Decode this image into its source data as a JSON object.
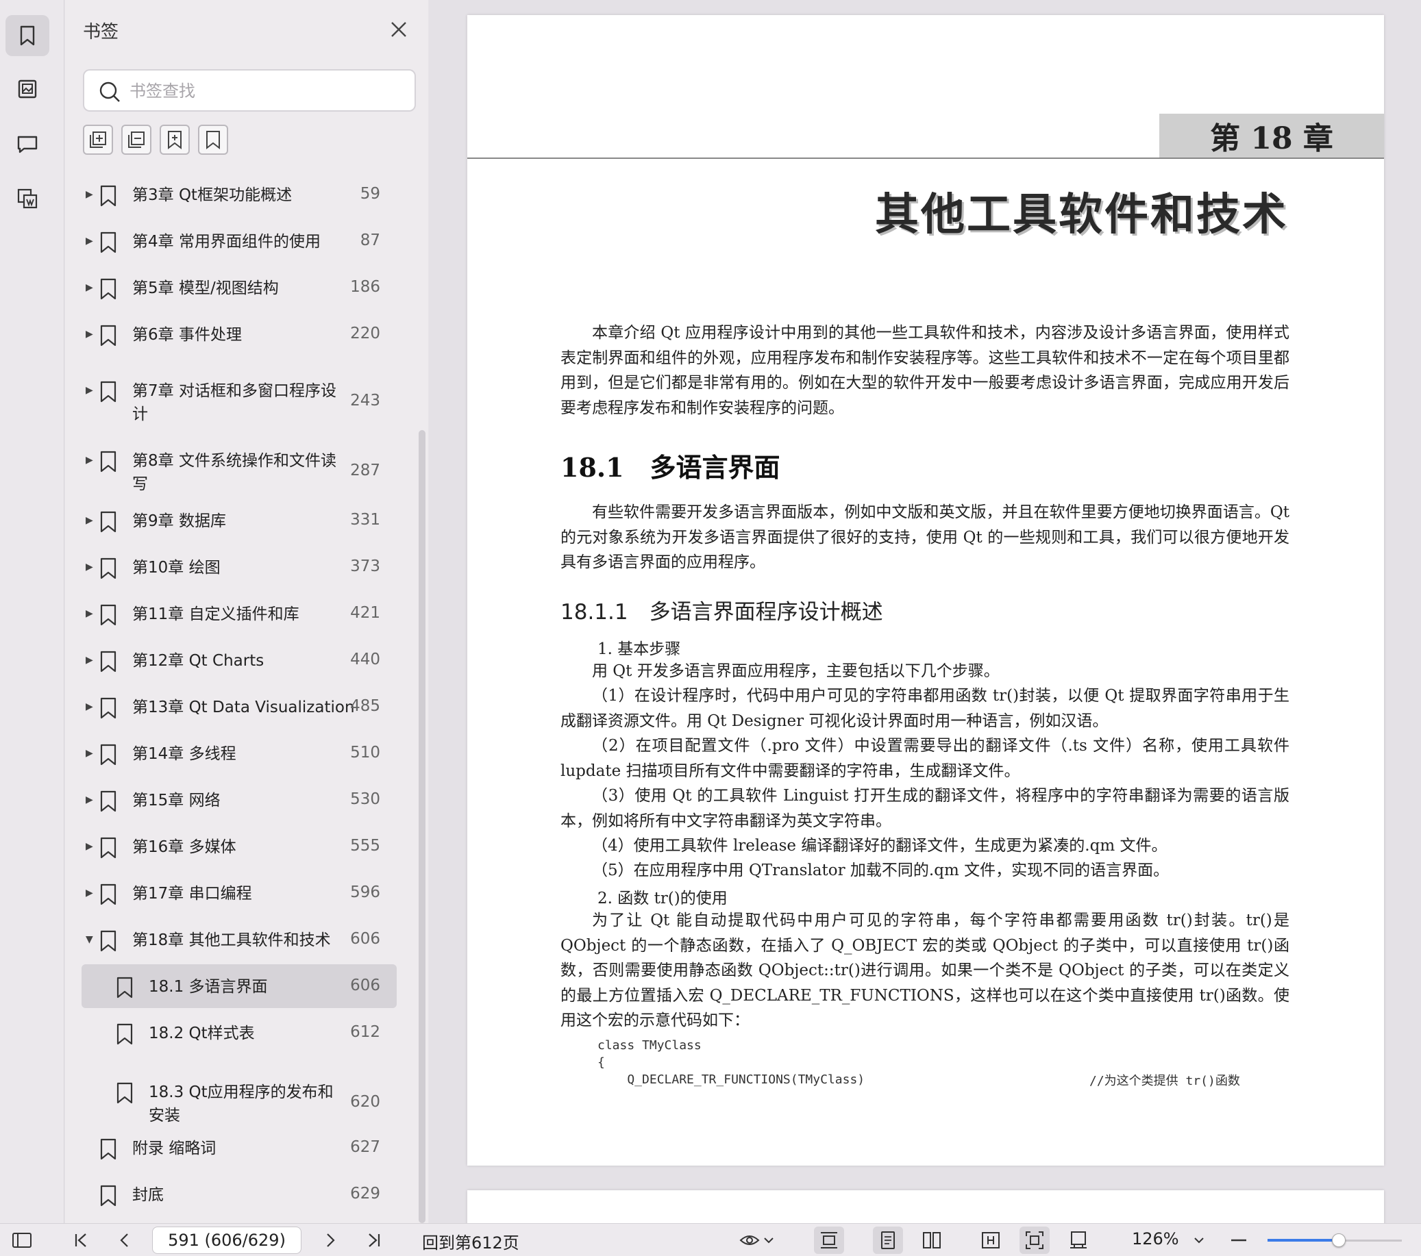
{
  "rail": {
    "items": [
      {
        "name": "bookmark-tab",
        "icon": "bookmark-icon"
      },
      {
        "name": "thumbnail-tab",
        "icon": "image-icon"
      },
      {
        "name": "comment-tab",
        "icon": "comment-icon"
      },
      {
        "name": "extract-tab",
        "icon": "extract-icon"
      }
    ]
  },
  "panel": {
    "title": "书签",
    "search_placeholder": "书签查找"
  },
  "toc": [
    {
      "label": "第3章 Qt框架功能概述",
      "page": "59"
    },
    {
      "label": "第4章 常用界面组件的使用",
      "page": "87"
    },
    {
      "label": "第5章 模型/视图结构",
      "page": "186"
    },
    {
      "label": "第6章 事件处理",
      "page": "220"
    },
    {
      "label": "第7章 对话框和多窗口程序设",
      "label2": "计",
      "page": "243"
    },
    {
      "label": "第8章 文件系统操作和文件读",
      "label2": "写",
      "page": "287"
    },
    {
      "label": "第9章 数据库",
      "page": "331"
    },
    {
      "label": "第10章 绘图",
      "page": "373"
    },
    {
      "label": "第11章 自定义插件和库",
      "page": "421"
    },
    {
      "label": "第12章 Qt Charts",
      "page": "440"
    },
    {
      "label": "第13章 Qt Data Visualization",
      "page": "485"
    },
    {
      "label": "第14章 多线程",
      "page": "510"
    },
    {
      "label": "第15章 网络",
      "page": "530"
    },
    {
      "label": "第16章 多媒体",
      "page": "555"
    },
    {
      "label": "第17章 串口编程",
      "page": "596"
    },
    {
      "label": "第18章 其他工具软件和技术",
      "page": "606"
    },
    {
      "label": "18.1 多语言界面",
      "page": "606"
    },
    {
      "label": "18.2 Qt样式表",
      "page": "612"
    },
    {
      "label": "18.3 Qt应用程序的发布和",
      "label2": "安装",
      "page": "620"
    },
    {
      "label": "附录 缩略词",
      "page": "627"
    },
    {
      "label": "封底",
      "page": "629"
    }
  ],
  "document": {
    "chapter_tab": "第 18 章",
    "chapter_title": "其他工具软件和技术",
    "intro": "本章介绍 Qt 应用程序设计中用到的其他一些工具软件和技术，内容涉及设计多语言界面，使用样式表定制界面和组件的外观，应用程序发布和制作安装程序等。这些工具软件和技术不一定在每个项目里都用到，但是它们都是非常有用的。例如在大型的软件开发中一般要考虑设计多语言界面，完成应用开发后要考虑程序发布和制作安装程序的问题。",
    "h2": "18.1　多语言界面",
    "p1": "有些软件需要开发多语言界面版本，例如中文版和英文版，并且在软件里要方便地切换界面语言。Qt 的元对象系统为开发多语言界面提供了很好的支持，使用 Qt 的一些规则和工具，我们可以很方便地开发具有多语言界面的应用程序。",
    "h3": "18.1.1　多语言界面程序设计概述",
    "step1": "1. 基本步骤",
    "p2": "用 Qt 开发多语言界面应用程序，主要包括以下几个步骤。",
    "p3": "（1）在设计程序时，代码中用户可见的字符串都用函数 tr()封装，以便 Qt 提取界面字符串用于生成翻译资源文件。用 Qt Designer 可视化设计界面时用一种语言，例如汉语。",
    "p4": "（2）在项目配置文件（.pro 文件）中设置需要导出的翻译文件（.ts 文件）名称，使用工具软件 lupdate 扫描项目所有文件中需要翻译的字符串，生成翻译文件。",
    "p5": "（3）使用 Qt 的工具软件 Linguist 打开生成的翻译文件，将程序中的字符串翻译为需要的语言版本，例如将所有中文字符串翻译为英文字符串。",
    "p6": "（4）使用工具软件 lrelease 编译翻译好的翻译文件，生成更为紧凑的.qm 文件。",
    "p7": "（5）在应用程序中用 QTranslator 加载不同的.qm 文件，实现不同的语言界面。",
    "step2": "2. 函数 tr()的使用",
    "p8": "为了让 Qt 能自动提取代码中用户可见的字符串，每个字符串都需要用函数 tr()封装。tr()是 QObject 的一个静态函数，在插入了 Q_OBJECT 宏的类或 QObject 的子类中，可以直接使用 tr()函数，否则需要使用静态函数 QObject::tr()进行调用。如果一个类不是 QObject 的子类，可以在类定义的最上方位置插入宏 Q_DECLARE_TR_FUNCTIONS，这样也可以在这个类中直接使用 tr()函数。使用这个宏的示意代码如下：",
    "code1": "class TMyClass",
    "code2": "{",
    "code3": "    Q_DECLARE_TR_FUNCTIONS(TMyClass)",
    "code_comment": "//为这个类提供 tr()函数"
  },
  "statusbar": {
    "page_value": "591 (606/629)",
    "goto_label": "回到第612页",
    "zoom_label": "126%",
    "zoom_fraction": 0.53
  },
  "colors": {
    "accent": "#3b7be8",
    "selected_row": "#d6d3d8",
    "panel_bg": "#eeebee"
  }
}
